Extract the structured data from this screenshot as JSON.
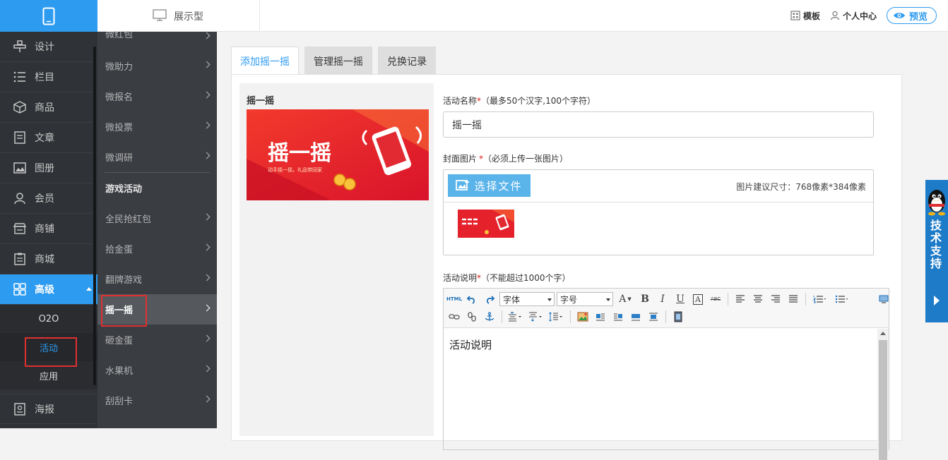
{
  "sidebar": {
    "items": [
      {
        "label": "设计",
        "icon": "design-icon"
      },
      {
        "label": "栏目",
        "icon": "list-icon"
      },
      {
        "label": "商品",
        "icon": "box-icon"
      },
      {
        "label": "文章",
        "icon": "article-icon"
      },
      {
        "label": "图册",
        "icon": "gallery-icon"
      },
      {
        "label": "会员",
        "icon": "user-icon"
      },
      {
        "label": "商铺",
        "icon": "store-icon"
      },
      {
        "label": "商城",
        "icon": "clipboard-icon"
      },
      {
        "label": "高级",
        "icon": "grid-icon"
      }
    ],
    "sub_items": [
      "O2O",
      "活动",
      "应用"
    ],
    "bottom_item": {
      "label": "海报",
      "icon": "poster-icon"
    }
  },
  "submenu": {
    "top_items": [
      "微红包",
      "微助力",
      "微报名",
      "微投票",
      "微调研"
    ],
    "section_title": "游戏活动",
    "game_items": [
      "全民抢红包",
      "拾金蛋",
      "翻牌游戏",
      "摇一摇",
      "砸金蛋",
      "水果机",
      "刮刮卡"
    ]
  },
  "topbar": {
    "site_type": "展示型",
    "template": "模板",
    "user_center": "个人中心",
    "preview": "预览"
  },
  "tabs": [
    "添加摇一摇",
    "管理摇一摇",
    "兑换记录"
  ],
  "preview_card": {
    "title": "摇一摇",
    "banner_title": "摇一摇",
    "banner_sub": "动手摇一摇，礼品带回家"
  },
  "form": {
    "name_label": "活动名称",
    "name_hint": "（最多50个汉字,100个字符）",
    "name_value": "摇一摇",
    "cover_label": "封面图片",
    "cover_hint": "（必须上传一张图片）",
    "choose_file": "选择文件",
    "size_hint": "图片建议尺寸：768像素*384像素",
    "desc_label": "活动说明",
    "desc_hint": "（不能超过1000个字）",
    "desc_value": "活动说明",
    "required_mark": "*"
  },
  "editor": {
    "html_btn": "HTML",
    "font_select": "字体",
    "size_select": "字号",
    "bold": "B",
    "italic": "I",
    "underline": "U",
    "font_a": "A",
    "border_a": "A",
    "strike": "ABC"
  },
  "support": {
    "text": "技术支持"
  },
  "colors": {
    "accent": "#2d9bf0",
    "sidebar": "#2f3236",
    "submenu": "#3a3d42",
    "support": "#1e7bc8",
    "required": "#e02020"
  }
}
